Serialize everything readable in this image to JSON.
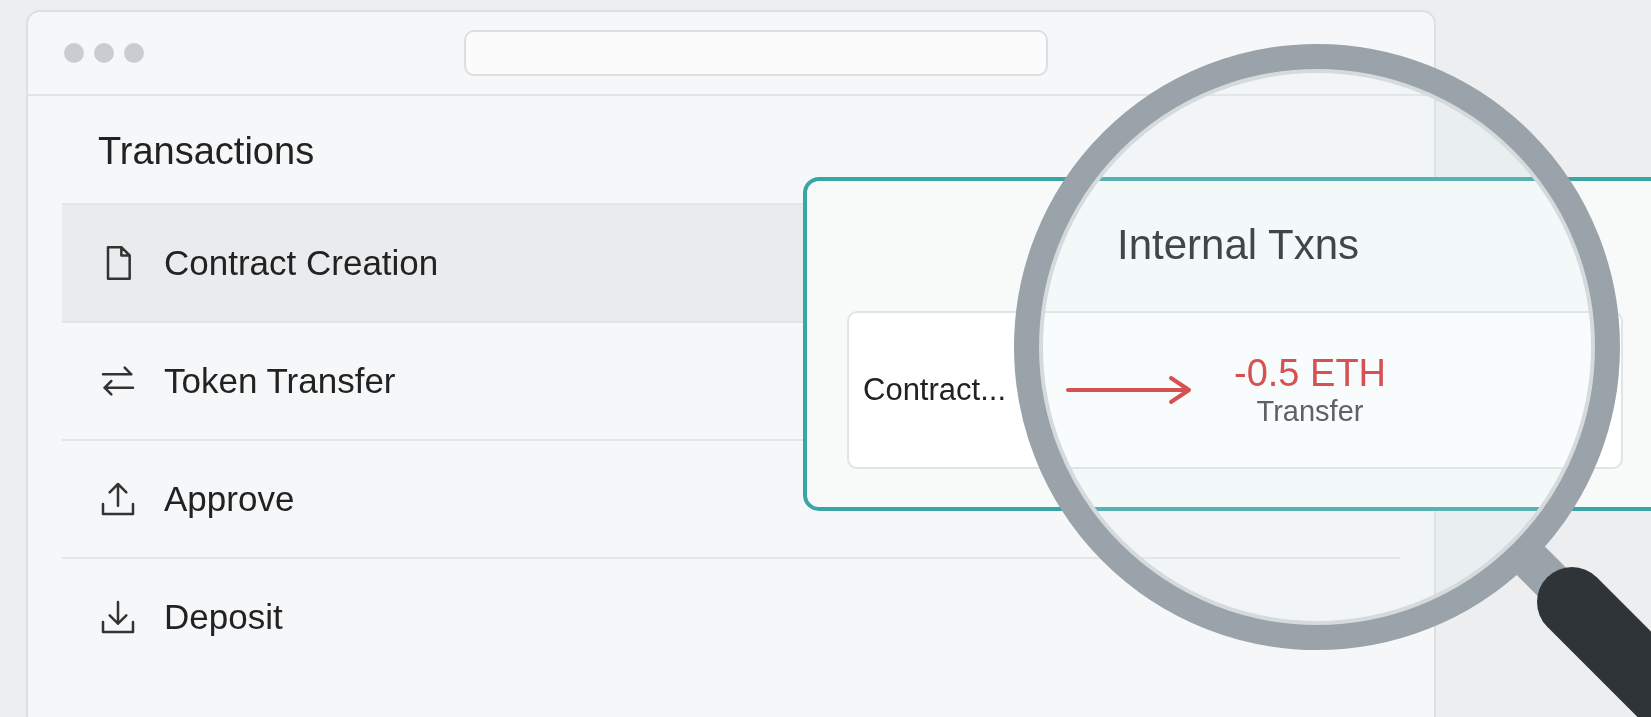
{
  "transactions": {
    "title": "Transactions",
    "items": [
      {
        "label": "Contract Creation",
        "kind": "document",
        "selected": true
      },
      {
        "label": "Token Transfer",
        "kind": "swap",
        "selected": false
      },
      {
        "label": "Approve",
        "kind": "upload",
        "selected": false
      },
      {
        "label": "Deposit",
        "kind": "download",
        "selected": false
      }
    ]
  },
  "internal": {
    "title": "Internal Txns",
    "row": {
      "source": "Contract...",
      "amount": "-0.5 ETH",
      "type": "Transfer"
    }
  }
}
